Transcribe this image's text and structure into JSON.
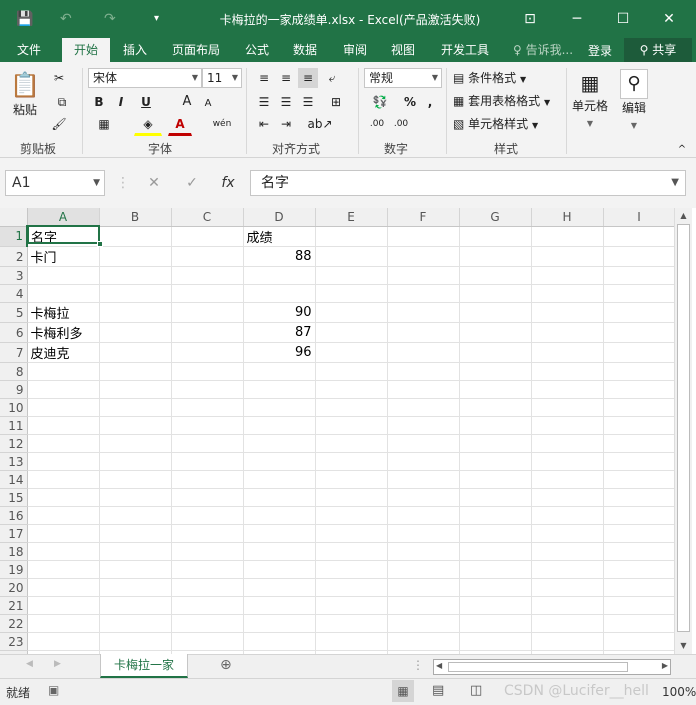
{
  "titlebar": {
    "title": "卡梅拉的一家成绩单.xlsx - Excel(产品激活失败)",
    "save_icon": "💾",
    "undo_icon": "↶",
    "redo_icon": "↷",
    "customize_icon": "▾",
    "ribbon_display_icon": "⊡",
    "minimize_icon": "─",
    "maximize_icon": "☐",
    "close_icon": "✕"
  },
  "menu": {
    "items": [
      "文件",
      "开始",
      "插入",
      "页面布局",
      "公式",
      "数据",
      "审阅",
      "视图",
      "开发工具"
    ],
    "tell_me": "告诉我...",
    "login": "登录",
    "share": "共享"
  },
  "ribbon": {
    "clipboard": {
      "label": "剪贴板",
      "paste": "粘贴",
      "paste_icon": "📋",
      "cut_icon": "✂",
      "copy_icon": "⧉",
      "painter_icon": "🖌"
    },
    "font": {
      "label": "字体",
      "name": "宋体",
      "size": "11",
      "bold": "B",
      "italic": "I",
      "underline": "U",
      "grow": "A",
      "shrink": "A",
      "phonetic": "wén",
      "font_color_letter": "A"
    },
    "alignment": {
      "label": "对齐方式"
    },
    "number": {
      "label": "数字",
      "format": "常规",
      "percent": "%",
      "comma": ",",
      "inc_decimal": ".00",
      "dec_decimal": ".00"
    },
    "styles": {
      "label": "样式",
      "conditional": "条件格式",
      "table": "套用表格格式",
      "cell_styles": "单元格样式"
    },
    "cells": {
      "label": "单元格"
    },
    "editing": {
      "label": "编辑"
    }
  },
  "formula_bar": {
    "name_box": "A1",
    "cancel": "✕",
    "enter": "✓",
    "fx": "fx",
    "content": "名字"
  },
  "columns": [
    "A",
    "B",
    "C",
    "D",
    "E",
    "F",
    "G",
    "H",
    "I"
  ],
  "rows": [
    [
      "名字",
      "",
      "",
      "成绩",
      "",
      "",
      "",
      "",
      ""
    ],
    [
      "卡门",
      "",
      "",
      "88",
      "",
      "",
      "",
      "",
      ""
    ],
    [
      "",
      "",
      "",
      "",
      "",
      "",
      "",
      "",
      ""
    ],
    [
      "",
      "",
      "",
      "",
      "",
      "",
      "",
      "",
      ""
    ],
    [
      "卡梅拉",
      "",
      "",
      "90",
      "",
      "",
      "",
      "",
      ""
    ],
    [
      "卡梅利多",
      "",
      "",
      "87",
      "",
      "",
      "",
      "",
      ""
    ],
    [
      "皮迪克",
      "",
      "",
      "96",
      "",
      "",
      "",
      "",
      ""
    ]
  ],
  "row_count": 24,
  "sheet_tab": "卡梅拉一家",
  "status": {
    "ready": "就绪",
    "zoom": "100%"
  },
  "watermark": "CSDN @Lucifer__hell"
}
